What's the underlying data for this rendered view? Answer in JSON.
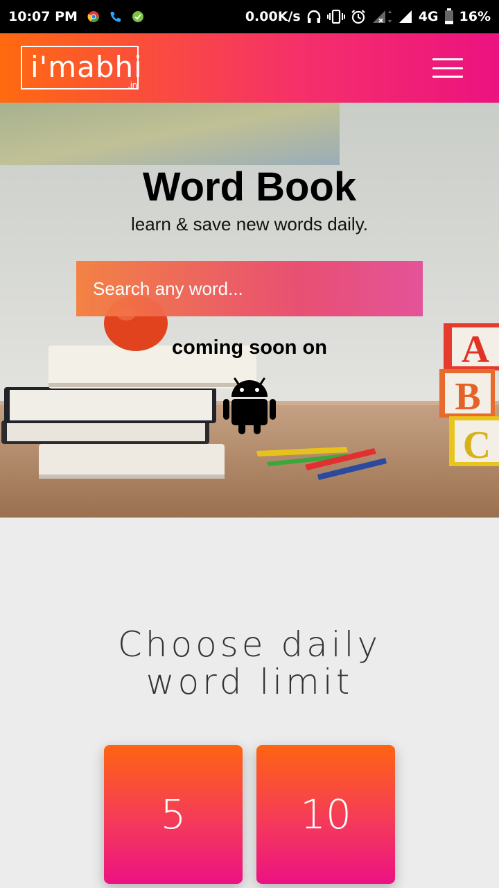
{
  "status_bar": {
    "time": "10:07 PM",
    "speed": "0.00K/s",
    "network": "4G",
    "battery": "16%"
  },
  "header": {
    "logo_text": "i'mabhi",
    "logo_suffix": ".in",
    "menu_icon": "hamburger-menu-icon"
  },
  "hero": {
    "title": "Word Book",
    "subtitle": "learn & save new words daily.",
    "search_placeholder": "Search any word...",
    "coming_soon": "coming soon on",
    "platform_icon": "android-icon"
  },
  "limit_section": {
    "title_line1": "Choose daily",
    "title_line2": "word limit",
    "options": [
      "5",
      "10"
    ]
  },
  "colors": {
    "gradient_start": "#ff6a10",
    "gradient_end": "#ec1280",
    "page_background": "#ececec"
  }
}
